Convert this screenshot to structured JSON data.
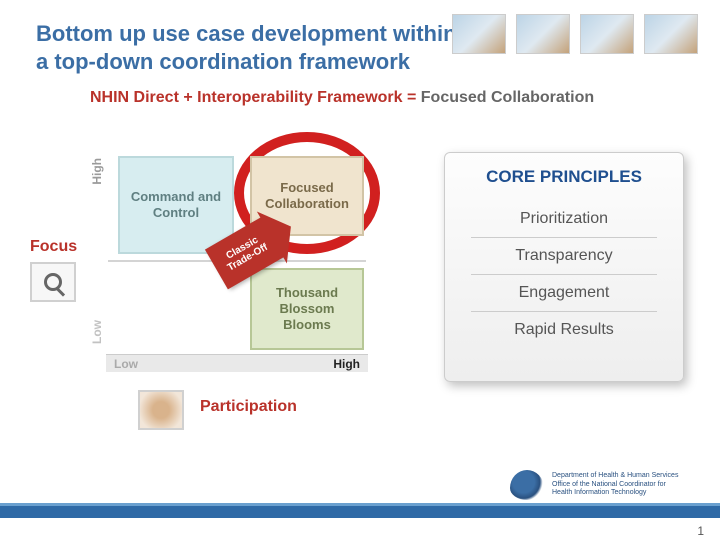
{
  "title": {
    "line1": "Bottom up use case development within",
    "line2": "a top-down coordination framework"
  },
  "subtitle": {
    "left": "NHIN Direct + Interoperability Framework = ",
    "right": "Focused Collaboration"
  },
  "focus": {
    "label": "Focus"
  },
  "participation": {
    "label": "Participation"
  },
  "chart": {
    "y_high": "High",
    "y_low": "Low",
    "x_low": "Low",
    "x_high": "High",
    "quadrants": {
      "top_left": "Command and Control",
      "top_right": "Focused Collaboration",
      "bottom_right": "Thousand Blossom Blooms"
    },
    "arrow": "Classic Trade-Off"
  },
  "panel": {
    "heading": "CORE PRINCIPLES",
    "items": [
      "Prioritization",
      "Transparency",
      "Engagement",
      "Rapid Results"
    ]
  },
  "logo": {
    "line1": "Department of Health & Human Services",
    "line2": "Office of the National Coordinator for",
    "line3": "Health Information Technology"
  },
  "page": "1"
}
